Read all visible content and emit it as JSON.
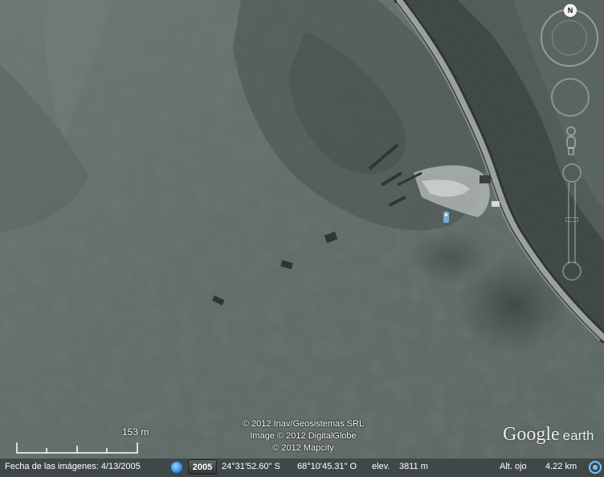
{
  "map": {
    "imagery": "satellite",
    "features": [
      "mountain-slope",
      "road"
    ],
    "colors": {
      "terrain": "#5b6762",
      "vegetation": "#3d4645",
      "road": "#9a9f9a",
      "status_bar": "#3f4848"
    }
  },
  "nav": {
    "north_label": "N",
    "icons": [
      "compass-icon",
      "look-around-icon",
      "pegman-icon",
      "zoom-in-icon",
      "zoom-slider-icon",
      "zoom-out-icon"
    ]
  },
  "scale": {
    "label": "153 m"
  },
  "attribution": {
    "line1": "© 2012 Inav/Geosistemas SRL",
    "line2": "Image © 2012 DigitalGlobe",
    "line3": "© 2012 Mapcity"
  },
  "logo": {
    "google": "Google",
    "earth": "earth"
  },
  "status": {
    "date_label": "Fecha de las imágenes: 4/13/2005",
    "year_button": "2005",
    "lat": "24°31'52.60\" S",
    "lon": "68°10'45.31\" O",
    "elev_label": "elev.",
    "elev_value": "3811 m",
    "eye_label": "Alt. ojo",
    "eye_value": "4.22 km"
  }
}
